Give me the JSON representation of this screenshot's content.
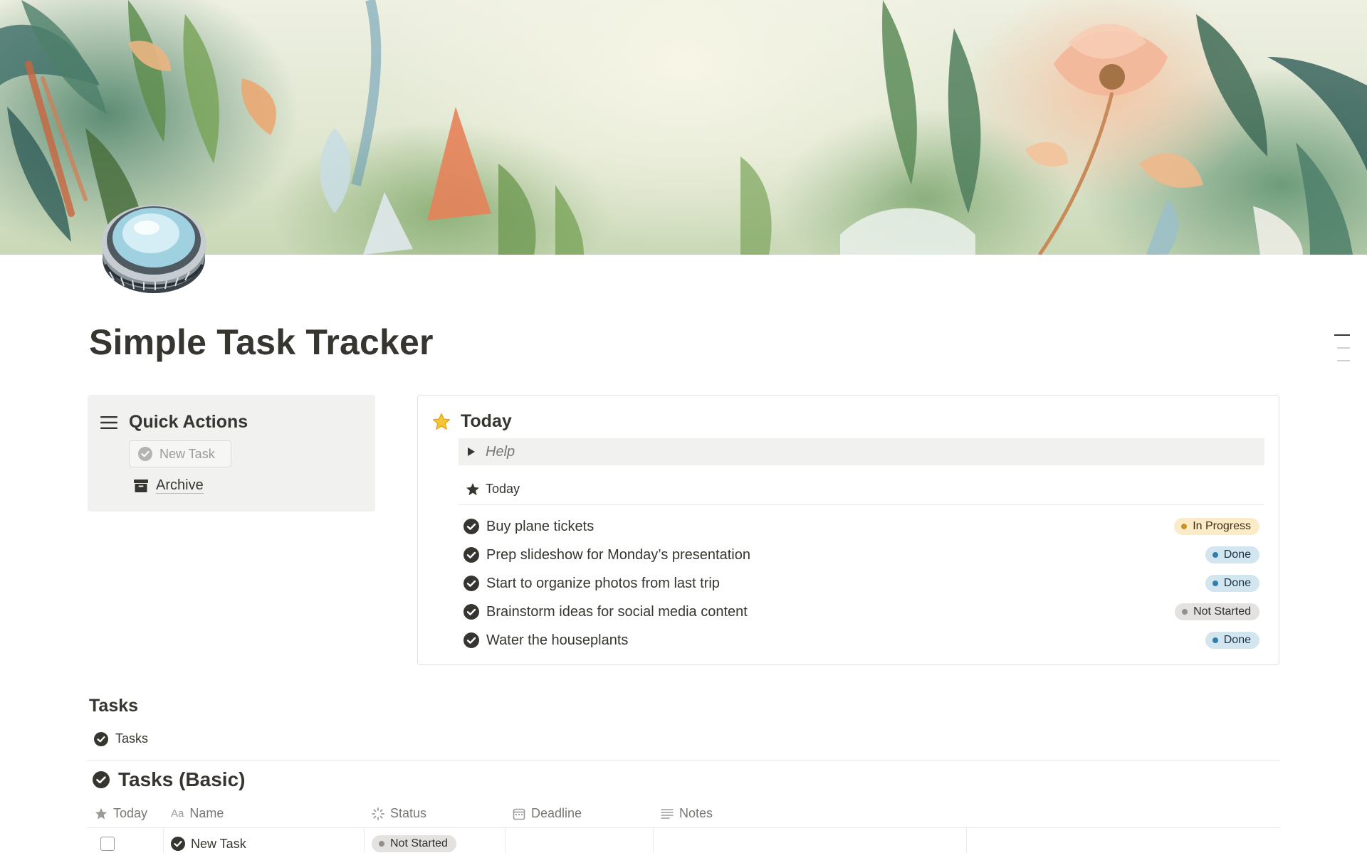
{
  "page": {
    "title": "Simple Task Tracker"
  },
  "quick_actions": {
    "title": "Quick Actions",
    "new_task_label": "New Task",
    "archive_label": "Archive"
  },
  "today_panel": {
    "title": "Today",
    "help_label": "Help",
    "view_label": "Today",
    "tasks": [
      {
        "name": "Buy plane tickets",
        "status": "In Progress",
        "status_bg": "#fbecc7",
        "status_dot": "#cb912f",
        "status_color": "#402c1b"
      },
      {
        "name": "Prep slideshow for Monday’s presentation",
        "status": "Done",
        "status_bg": "#d3e5ef",
        "status_dot": "#337ea9",
        "status_color": "#183347"
      },
      {
        "name": "Start to organize photos from last trip",
        "status": "Done",
        "status_bg": "#d3e5ef",
        "status_dot": "#337ea9",
        "status_color": "#183347"
      },
      {
        "name": "Brainstorm ideas for social media content",
        "status": "Not Started",
        "status_bg": "#e3e2e0",
        "status_dot": "#91918e",
        "status_color": "#32302c"
      },
      {
        "name": "Water the houseplants",
        "status": "Done",
        "status_bg": "#d3e5ef",
        "status_dot": "#337ea9",
        "status_color": "#183347"
      }
    ]
  },
  "tasks_section": {
    "title": "Tasks",
    "view_label": "Tasks",
    "database_title": "Tasks (Basic)",
    "columns": [
      "Today",
      "Name",
      "Status",
      "Deadline",
      "Notes"
    ],
    "rows": [
      {
        "today_checked": false,
        "name": "New Task",
        "status": "Not Started",
        "deadline": "",
        "notes": ""
      }
    ]
  },
  "icons": {
    "quick_actions": "hamburger-menu-icon",
    "new_task": "check-circle-icon",
    "archive": "archive-box-icon",
    "today": "star-emoji-icon",
    "help": "triangle-right-icon",
    "view": "star-icon",
    "task": "check-circle-icon",
    "status_col": "loading-spinner-icon",
    "deadline_col": "calendar-icon",
    "notes_col": "text-lines-icon",
    "name_col": "text-aa-icon"
  }
}
